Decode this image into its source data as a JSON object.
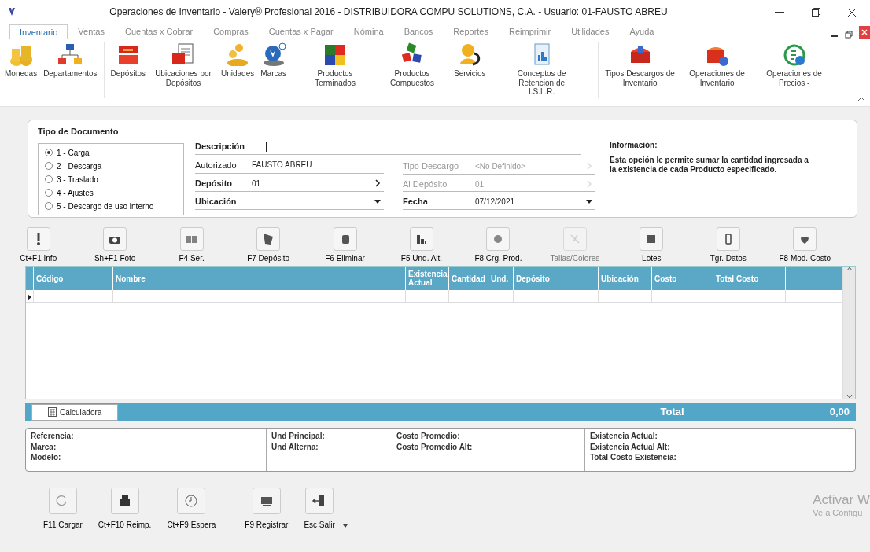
{
  "window": {
    "title": "Operaciones de Inventario - Valery® Profesional 2016 - DISTRIBUIDORA COMPU SOLUTIONS, C.A. - Usuario: 01-FAUSTO ABREU"
  },
  "tabs": [
    {
      "label": "Inventario",
      "selected": true
    },
    {
      "label": "Ventas",
      "selected": false
    },
    {
      "label": "Cuentas x Cobrar",
      "selected": false
    },
    {
      "label": "Compras",
      "selected": false
    },
    {
      "label": "Cuentas x Pagar",
      "selected": false
    },
    {
      "label": "Nómina",
      "selected": false
    },
    {
      "label": "Bancos",
      "selected": false
    },
    {
      "label": "Reportes",
      "selected": false
    },
    {
      "label": "Reimprimir",
      "selected": false
    },
    {
      "label": "Utilidades",
      "selected": false
    },
    {
      "label": "Ayuda",
      "selected": false
    }
  ],
  "ribbon": [
    "Monedas",
    "Departamentos",
    "Depósitos",
    "Ubicaciones por Depósitos",
    "Unidades",
    "Marcas",
    "Productos Terminados",
    "Productos Compuestos",
    "Servicios",
    "Conceptos de Retencion de I.S.L.R.",
    "Tipos Descargos de Inventario",
    "Operaciones de Inventario",
    "Operaciones de Precios -"
  ],
  "document_type": {
    "title": "Tipo de Documento",
    "options": [
      {
        "label": "1 - Carga",
        "selected": true
      },
      {
        "label": "2 - Descarga",
        "selected": false
      },
      {
        "label": "3 - Traslado",
        "selected": false
      },
      {
        "label": "4 - Ajustes",
        "selected": false
      },
      {
        "label": "5 - Descargo de uso interno",
        "selected": false
      }
    ]
  },
  "description": {
    "label": "Descripción"
  },
  "fields_left": [
    {
      "label": "Autorizado",
      "value": "FAUSTO ABREU",
      "kind": "text",
      "disabled": false
    },
    {
      "label": "Depósito",
      "value": "01",
      "kind": "lookup",
      "disabled": false
    },
    {
      "label": "Ubicación",
      "kind": "dropdown",
      "disabled": false
    }
  ],
  "fields_right": [
    {
      "label": "Tipo Descargo",
      "value": "<No Definido>",
      "kind": "lookup",
      "disabled": true
    },
    {
      "label": "Al Depósito",
      "value": "01",
      "kind": "lookup",
      "disabled": true
    },
    {
      "label": "Fecha",
      "value": "07/12/2021",
      "kind": "dropdown",
      "disabled": false
    }
  ],
  "information": {
    "title": "Información:",
    "text": "Esta opción le permite sumar la cantidad ingresada a la existencia de cada Producto especificado."
  },
  "toolbar": [
    {
      "label": "Ct+F1 Info",
      "disabled": false
    },
    {
      "label": "Sh+F1 Foto",
      "disabled": false
    },
    {
      "label": "F4 Ser.",
      "disabled": false
    },
    {
      "label": "F7 Depósito",
      "disabled": false
    },
    {
      "label": "F6 Eliminar",
      "disabled": false
    },
    {
      "label": "F5 Und. Alt.",
      "disabled": false
    },
    {
      "label": "F8 Crg. Prod.",
      "disabled": false
    },
    {
      "label": "Tallas/Colores",
      "disabled": true
    },
    {
      "label": "Lotes",
      "disabled": false
    },
    {
      "label": "Tgr. Datos",
      "disabled": false
    },
    {
      "label": "F8 Mod. Costo",
      "disabled": false
    }
  ],
  "table": {
    "columns": [
      "Código",
      "Nombre",
      "Existencia Actual",
      "Cantidad",
      "Und.",
      "Depósito",
      "Ubicación",
      "Costo",
      "Total Costo"
    ]
  },
  "totals": {
    "calculator": "Calculadora",
    "label": "Total",
    "value": "0,00"
  },
  "details": [
    [
      "Referencia:",
      "Marca:",
      "Modelo:"
    ],
    [
      "Und Principal:",
      "Und Alterna:"
    ],
    [
      "Costo Promedio:",
      "Costo Promedio Alt:"
    ],
    [
      "Existencia Actual:",
      "Existencia Actual Alt:",
      "Total Costo Existencia:"
    ]
  ],
  "bottom_toolbar": [
    "F11 Cargar",
    "Ct+F10 Reimp.",
    "Ct+F9 Espera",
    "F9 Registrar",
    "Esc Salir"
  ],
  "activation_notice": [
    "Activar W",
    "Ve a Configu"
  ]
}
